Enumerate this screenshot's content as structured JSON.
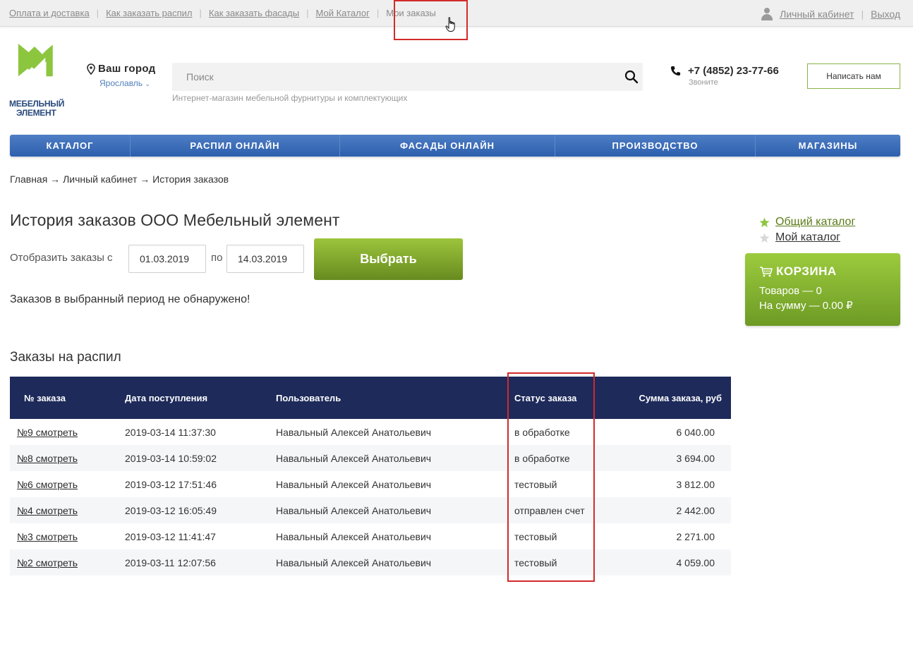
{
  "topbar": {
    "links": [
      "Оплата и доставка",
      "Как заказать распил",
      "Как заказать фасады",
      "Мой Каталог"
    ],
    "current": "Мои заказы",
    "account": "Личный кабинет",
    "logout": "Выход"
  },
  "header": {
    "logo_line1": "МЕБЕЛЬНЫЙ",
    "logo_line2": "ЭЛЕМЕНТ",
    "city_label": "Ваш город",
    "city_value": "Ярославль",
    "search_placeholder": "Поиск",
    "tagline": "Интернет-магазин мебельной фурнитуры и комплектующих",
    "phone": "+7 (4852) 23-77-66",
    "phone_sub": "Звоните",
    "write_button": "Написать нам"
  },
  "nav": [
    "КАТАЛОГ",
    "РАСПИЛ ОНЛАЙН",
    "ФАСАДЫ ОНЛАЙН",
    "ПРОИЗВОДСТВО",
    "МАГАЗИНЫ"
  ],
  "breadcrumb": "Главная → Личный кабинет → История заказов",
  "page_title": "История заказов ООО Мебельный элемент",
  "filter": {
    "label": "Отобразить заказы с",
    "from": "01.03.2019",
    "to_label": "по",
    "to": "14.03.2019",
    "button": "Выбрать"
  },
  "no_orders": "Заказов в выбранный период не обнаружено!",
  "sidebar": {
    "general_catalog": "Общий каталог",
    "my_catalog": "Мой каталог",
    "cart_title": "КОРЗИНА",
    "cart_items": "Товаров — 0",
    "cart_sum": "На сумму — 0.00 ₽"
  },
  "cut_orders": {
    "title": "Заказы на распил",
    "headers": [
      "№ заказа",
      "Дата поступления",
      "Пользователь",
      "Статус заказа",
      "Сумма заказа, руб"
    ],
    "rows": [
      {
        "num": "№9 смотреть",
        "date": "2019-03-14 11:37:30",
        "user": "Навальный Алексей Анатольевич",
        "status": "в обработке",
        "sum": "6 040.00"
      },
      {
        "num": "№8 смотреть",
        "date": "2019-03-14 10:59:02",
        "user": "Навальный Алексей Анатольевич",
        "status": "в обработке",
        "sum": "3 694.00"
      },
      {
        "num": "№6 смотреть",
        "date": "2019-03-12 17:51:46",
        "user": "Навальный Алексей Анатольевич",
        "status": "тестовый",
        "sum": "3 812.00"
      },
      {
        "num": "№4 смотреть",
        "date": "2019-03-12 16:05:49",
        "user": "Навальный Алексей Анатольевич",
        "status": "отправлен счет",
        "sum": "2 442.00"
      },
      {
        "num": "№3 смотреть",
        "date": "2019-03-12 11:41:47",
        "user": "Навальный Алексей Анатольевич",
        "status": "тестовый",
        "sum": "2 271.00"
      },
      {
        "num": "№2 смотреть",
        "date": "2019-03-11 12:07:56",
        "user": "Навальный Алексей Анатольевич",
        "status": "тестовый",
        "sum": "4 059.00"
      }
    ]
  },
  "colors": {
    "accent_green": "#8ab34a",
    "nav_blue": "#3d6cb8",
    "table_header": "#1d2a5a",
    "highlight_red": "#d22a2a"
  }
}
